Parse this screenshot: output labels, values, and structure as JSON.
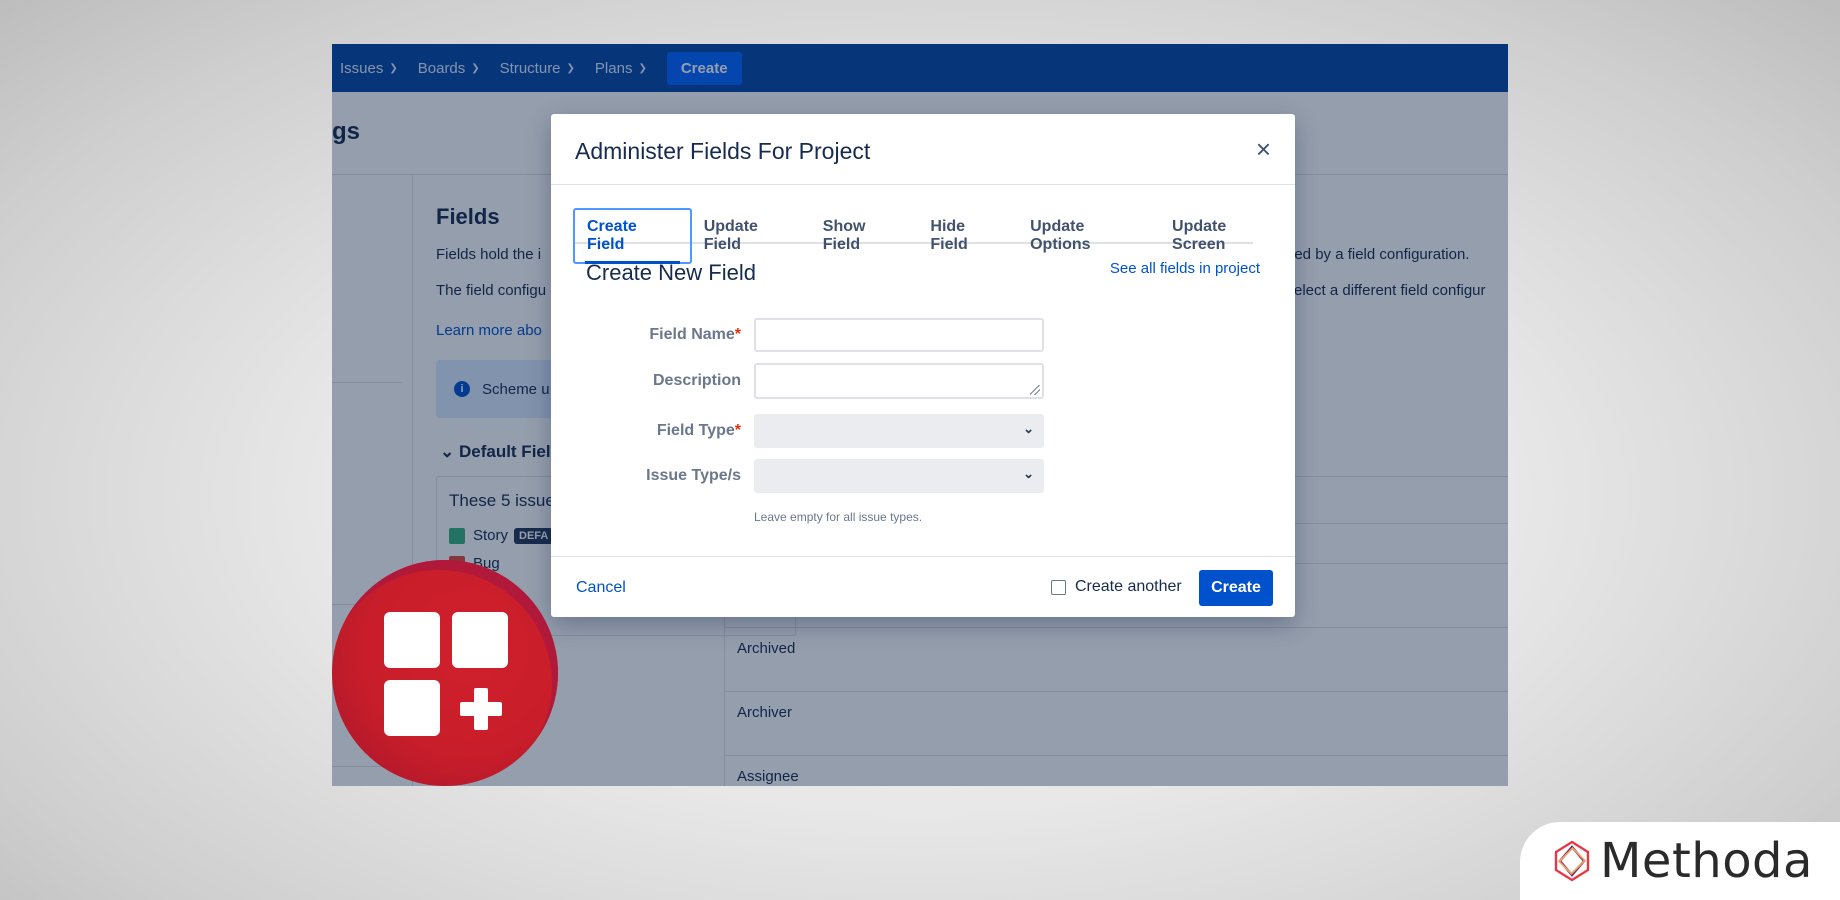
{
  "nav": {
    "items": [
      "Issues",
      "Boards",
      "Structure",
      "Plans"
    ],
    "create_label": "Create"
  },
  "background": {
    "page_title_fragment": "gs",
    "fields_heading": "Fields",
    "line1_left": "Fields hold the i",
    "line1_right": "ned by a field configuration.",
    "line2_left": "The field configu",
    "line2_right": "elect a different field configur",
    "learn_more": "Learn more abo",
    "info_text": "Scheme u",
    "default_fields": "Default Fiel",
    "issues_title": "These 5 issue",
    "issue_story": "Story",
    "badge_default": "DEFA",
    "issue_bug": "Bug",
    "table_rows": [
      "Archived",
      "Archiver",
      "Assignee"
    ]
  },
  "modal": {
    "title": "Administer Fields For Project",
    "close_symbol": "×",
    "tabs": [
      "Create Field",
      "Update Field",
      "Show Field",
      "Hide Field",
      "Update Options",
      "Update Screen"
    ],
    "section_title": "Create New Field",
    "see_all_link": "See all fields in project",
    "fields": {
      "field_name_label": "Field Name",
      "description_label": "Description",
      "field_type_label": "Field Type",
      "issue_types_label": "Issue Type/s",
      "required_mark": "*"
    },
    "helper_text": "Leave empty for all issue types.",
    "cancel_label": "Cancel",
    "create_another_label": "Create another",
    "create_label": "Create"
  },
  "brand": {
    "methoda": "Methoda"
  },
  "colors": {
    "nav_blue": "#0747a6",
    "primary": "#0052cc",
    "logo_red": "#c81d2a"
  }
}
